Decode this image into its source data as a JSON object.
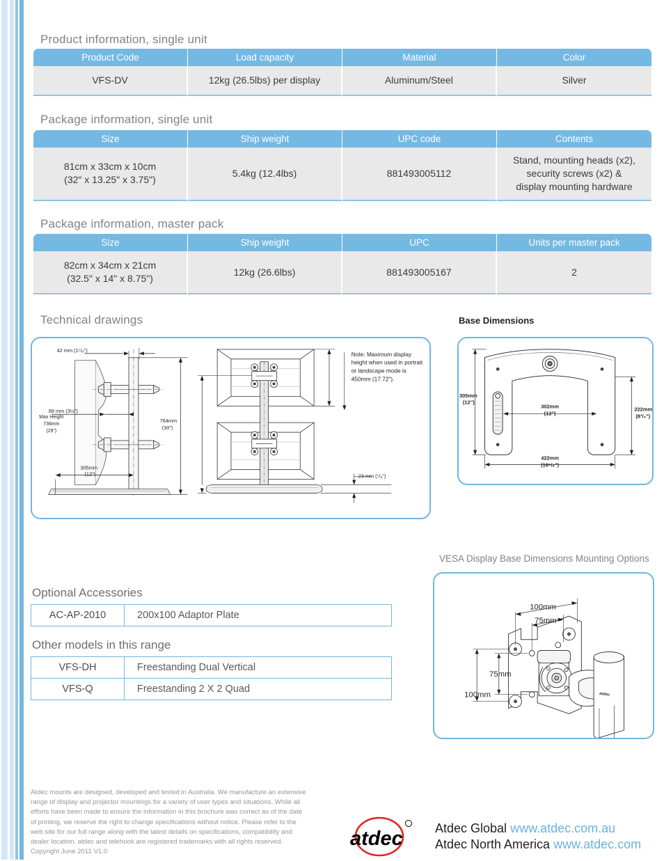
{
  "sections": {
    "product_info": "Product information, single unit",
    "package_single": "Package information, single unit",
    "package_master": "Package information, master pack",
    "technical_drawings": "Technical drawings",
    "base_dimensions": "Base Dimensions",
    "vesa_caption": "VESA Display Base Dimensions Mounting Options",
    "optional_accessories": "Optional Accessories",
    "other_models": "Other models in this range"
  },
  "product_table": {
    "headers": [
      "Product Code",
      "Load capacity",
      "Material",
      "Color"
    ],
    "rows": [
      [
        "VFS-DV",
        "12kg (26.5lbs) per display",
        "Aluminum/Steel",
        "Silver"
      ]
    ]
  },
  "package_single_table": {
    "headers": [
      "Size",
      "Ship weight",
      "UPC code",
      "Contents"
    ],
    "size_lines": [
      "81cm x 33cm x 10cm",
      "(32\" x 13.25\" x 3.75\")"
    ],
    "ship_weight": "5.4kg (12.4lbs)",
    "upc": "881493005112",
    "contents_lines": [
      "Stand, mounting heads (x2),",
      "security screws (x2) &",
      "display mounting hardware"
    ]
  },
  "package_master_table": {
    "headers": [
      "Size",
      "Ship weight",
      "UPC",
      "Units per master pack"
    ],
    "size_lines": [
      "82cm x 34cm x 21cm",
      "(32.5\" x 14\" x 8.75\")"
    ],
    "ship_weight": "12kg (26.6lbs)",
    "upc": "881493005167",
    "units": "2"
  },
  "drawing_side": {
    "depth": "42 mm (1⁵/₈\")",
    "offset": "89 mm (3½\")",
    "height_l1": "764mm",
    "height_l2": "(30\")",
    "base_depth_l1": "305mm",
    "base_depth_l2": "(12\")"
  },
  "drawing_front": {
    "max_height_l1": "Max Height",
    "max_height_l2": "736mm",
    "max_height_l3": "(29\")",
    "base_thickness": "23 mm (⁷/₈\")",
    "note_lines": [
      "Note:   Maximum display",
      "height when used in portrait",
      "or landscape mode is",
      "450mm (17.72\")."
    ]
  },
  "base_drawing": {
    "depth_l1": "305mm",
    "depth_l2": "(12\")",
    "inner_height_l1": "222mm",
    "inner_height_l2": "(8³/₄\")",
    "inner_width_l1": "302mm",
    "inner_width_l2": "(12\")",
    "outer_width_l1": "422mm",
    "outer_width_l2": "(16⁵/₈\")"
  },
  "vesa_drawing": {
    "top_100": "100mm",
    "top_75": "75mm",
    "side_75": "75mm",
    "side_100": "100mm",
    "brand_mark": "atdec"
  },
  "accessories": {
    "rows": [
      {
        "code": "AC-AP-2010",
        "desc": "200x100 Adaptor Plate"
      }
    ]
  },
  "models": {
    "rows": [
      {
        "code": "VFS-DH",
        "desc": "Freestanding Dual Vertical"
      },
      {
        "code": "VFS-Q",
        "desc": "Freestanding 2 X 2 Quad"
      }
    ]
  },
  "footer": {
    "disclaimer_lines": [
      "Atdec mounts are designed, developed and tested in Australia. We manufacture an extensive",
      "range of display and projector mountings for a variety of user types and situations. While all",
      "efforts have been made to ensure the information in this brochure was correct as of the date",
      "of printing, we reserve the right to change specifications without notice. Please refer to the",
      "web site for our full range along with the latest details on specifications, compatibility and",
      "dealer location. atdec and telehook are registered trademarks with all rights reserved.",
      "Copyright June 2011 V1.0"
    ],
    "logo_text": "atdec",
    "global_label": "Atdec Global",
    "global_url": "www.atdec.com.au",
    "na_label": "Atdec North America",
    "na_url": "www.atdec.com"
  },
  "colors": {
    "header_blue": "#74b9e3",
    "border_blue": "#74b4e0",
    "row_gray": "#e9e9e9",
    "link_blue": "#6ab3e0",
    "logo_red": "#e2231a",
    "heading_gray": "#808285"
  }
}
